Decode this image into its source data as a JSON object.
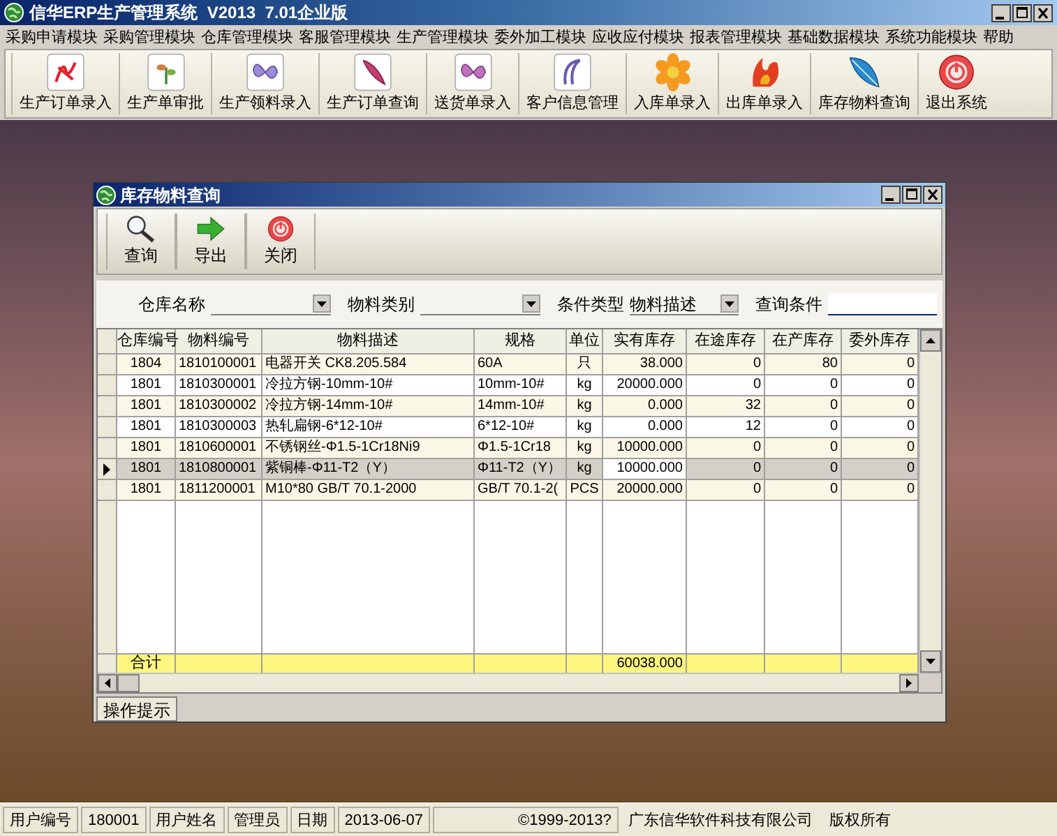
{
  "window": {
    "title": "信华ERP生产管理系统  V2013  7.01企业版"
  },
  "menu": [
    "采购申请模块",
    "采购管理模块",
    "仓库管理模块",
    "客服管理模块",
    "生产管理模块",
    "委外加工模块",
    "应收应付模块",
    "报表管理模块",
    "基础数据模块",
    "系统功能模块",
    "帮助"
  ],
  "toolbar": [
    "生产订单录入",
    "生产单审批",
    "生产领料录入",
    "生产订单查询",
    "送货单录入",
    "客户信息管理",
    "入库单录入",
    "出库单录入",
    "库存物料查询",
    "退出系统"
  ],
  "child_window": {
    "title": "库存物料查询",
    "toolbar": [
      "查询",
      "导出",
      "关闭"
    ],
    "filters": [
      {
        "label": "仓库名称",
        "kind": "dropdown"
      },
      {
        "label": "物料类别",
        "kind": "dropdown"
      },
      {
        "label": "条件类型",
        "kind": "dropdown",
        "value": "物料描述"
      },
      {
        "label": "查询条件",
        "kind": "text"
      }
    ],
    "table": {
      "columns": [
        "仓库编号",
        "物料编号",
        "物料描述",
        "规格",
        "单位",
        "实有库存",
        "在途库存",
        "在产库存",
        "委外库存"
      ],
      "rows": [
        {
          "cells": [
            "1804",
            "1810100001",
            "电器开关 CK8.205.584",
            "60A",
            "只",
            "38.000",
            "0",
            "80",
            "0"
          ],
          "selected": false
        },
        {
          "cells": [
            "1801",
            "1810300001",
            "冷拉方钢-10mm-10#",
            "10mm-10#",
            "kg",
            "20000.000",
            "0",
            "0",
            "0"
          ],
          "selected": false
        },
        {
          "cells": [
            "1801",
            "1810300002",
            "冷拉方钢-14mm-10#",
            "14mm-10#",
            "kg",
            "0.000",
            "32",
            "0",
            "0"
          ],
          "selected": false
        },
        {
          "cells": [
            "1801",
            "1810300003",
            "热轧扁钢-6*12-10#",
            "6*12-10#",
            "kg",
            "0.000",
            "12",
            "0",
            "0"
          ],
          "selected": false
        },
        {
          "cells": [
            "1801",
            "1810600001",
            "不锈钢丝-Φ1.5-1Cr18Ni9",
            "Φ1.5-1Cr18",
            "kg",
            "10000.000",
            "0",
            "0",
            "0"
          ],
          "selected": false
        },
        {
          "cells": [
            "1801",
            "1810800001",
            "紫铜棒-Φ11-T2（Y）",
            "Φ11-T2（Y）",
            "kg",
            "10000.000",
            "0",
            "0",
            "0"
          ],
          "selected": true
        },
        {
          "cells": [
            "1801",
            "1811200001",
            "M10*80 GB/T 70.1-2000",
            "GB/T 70.1-2(",
            "PCS",
            "20000.000",
            "0",
            "0",
            "0"
          ],
          "selected": false
        }
      ],
      "total": {
        "label": "合计",
        "stock": "60038.000"
      }
    },
    "hint_tab": "操作提示"
  },
  "status_bar": [
    "用户编号",
    "180001",
    "用户姓名",
    "管理员",
    "日期",
    "2013-06-07",
    "©1999-2013?",
    "广东信华软件科技有限公司",
    "版权所有"
  ]
}
